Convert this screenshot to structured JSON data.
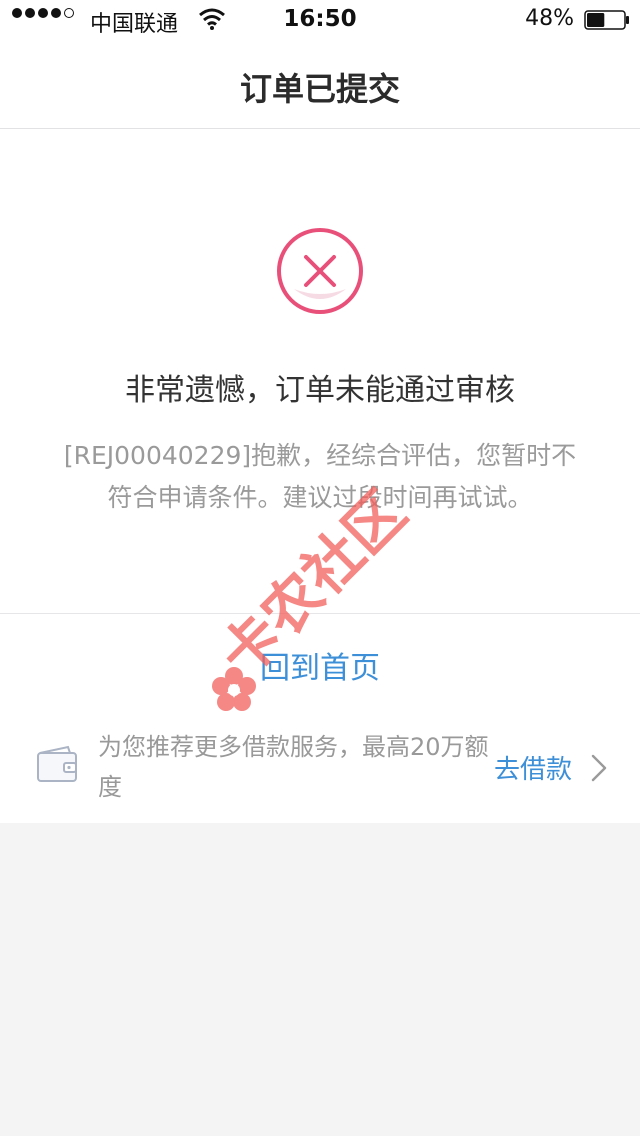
{
  "status_bar": {
    "carrier": "中国联通",
    "time": "16:50",
    "battery_percent": "48%",
    "battery_level": 0.48
  },
  "navbar": {
    "title": "订单已提交"
  },
  "result": {
    "icon": "close-circle-icon",
    "title": "非常遗憾，订单未能通过审核",
    "message": "[REJ00040229]抱歉，经综合评估，您暂时不符合申请条件。建议过段时间再试试。"
  },
  "actions": {
    "home_label": "回到首页"
  },
  "promo": {
    "text": "为您推荐更多借款服务，最高20万额度",
    "link_label": "去借款",
    "icon": "wallet-icon"
  },
  "watermark": {
    "text": "卡农社区"
  },
  "colors": {
    "accent_blue": "#3d8fd8",
    "error_pink": "#e8507a",
    "watermark_red": "#f25f5c"
  }
}
